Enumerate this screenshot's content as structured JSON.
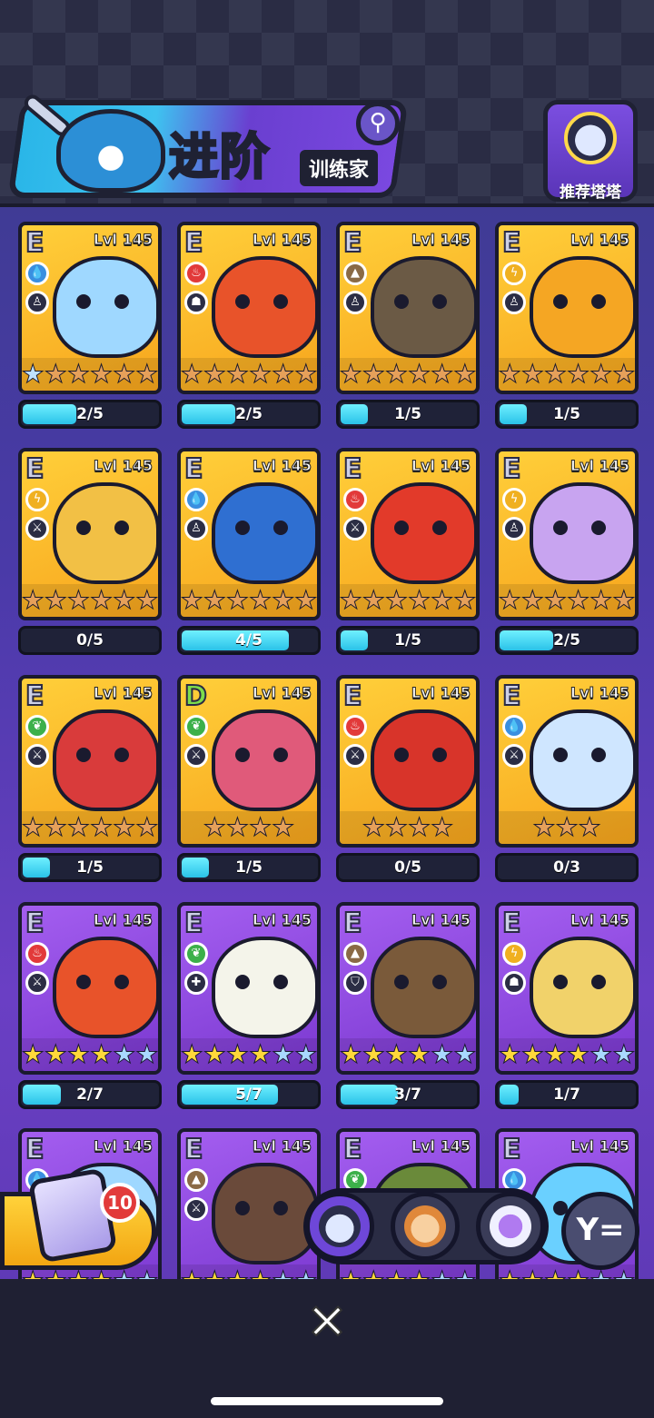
{
  "header": {
    "title": "进阶",
    "subtitle": "训练家",
    "recommend_label": "推荐塔塔",
    "icons": {
      "search": "search-icon",
      "recommend": "tata-robot-icon"
    }
  },
  "cards": [
    {
      "rank": "E",
      "level": "Lvl 145",
      "element": "water",
      "role": "bag",
      "stars": [
        "s",
        "b",
        "b",
        "b",
        "b",
        "b"
      ],
      "progress_text": "2/5",
      "progress": 0.4,
      "bg": "gold",
      "color": "#9fd8ff"
    },
    {
      "rank": "E",
      "level": "Lvl 145",
      "element": "fire",
      "role": "ghost",
      "stars": [
        "b",
        "b",
        "b",
        "b",
        "b",
        "b"
      ],
      "progress_text": "2/5",
      "progress": 0.4,
      "bg": "gold",
      "color": "#e8532a"
    },
    {
      "rank": "E",
      "level": "Lvl 145",
      "element": "earth",
      "role": "bag",
      "stars": [
        "b",
        "b",
        "b",
        "b",
        "b",
        "b"
      ],
      "progress_text": "1/5",
      "progress": 0.2,
      "bg": "gold",
      "color": "#6b5a45"
    },
    {
      "rank": "E",
      "level": "Lvl 145",
      "element": "electric",
      "role": "bag",
      "stars": [
        "b",
        "b",
        "b",
        "b",
        "b",
        "b"
      ],
      "progress_text": "1/5",
      "progress": 0.2,
      "bg": "gold",
      "color": "#f5a623"
    },
    {
      "rank": "E",
      "level": "Lvl 145",
      "element": "electric",
      "role": "sword",
      "stars": [
        "b",
        "b",
        "b",
        "b",
        "b",
        "b"
      ],
      "progress_text": "0/5",
      "progress": 0.0,
      "bg": "gold",
      "color": "#f2c045"
    },
    {
      "rank": "E",
      "level": "Lvl 145",
      "element": "water",
      "role": "bag",
      "stars": [
        "b",
        "b",
        "b",
        "b",
        "b",
        "b"
      ],
      "progress_text": "4/5",
      "progress": 0.8,
      "bg": "gold",
      "color": "#2f6fd1"
    },
    {
      "rank": "E",
      "level": "Lvl 145",
      "element": "fire",
      "role": "sword",
      "stars": [
        "b",
        "b",
        "b",
        "b",
        "b",
        "b"
      ],
      "progress_text": "1/5",
      "progress": 0.2,
      "bg": "gold",
      "color": "#e23a2a"
    },
    {
      "rank": "E",
      "level": "Lvl 145",
      "element": "electric",
      "role": "bag",
      "stars": [
        "b",
        "b",
        "b",
        "b",
        "b",
        "b"
      ],
      "progress_text": "2/5",
      "progress": 0.4,
      "bg": "gold",
      "color": "#c8a4f0"
    },
    {
      "rank": "E",
      "level": "Lvl 145",
      "element": "leaf",
      "role": "sword",
      "stars": [
        "b",
        "b",
        "b",
        "b",
        "b",
        "b"
      ],
      "progress_text": "1/5",
      "progress": 0.2,
      "bg": "gold",
      "color": "#d93b3b"
    },
    {
      "rank": "D",
      "level": "Lvl 145",
      "element": "leaf",
      "role": "sword",
      "stars": [
        "b",
        "b",
        "b",
        "b"
      ],
      "progress_text": "1/5",
      "progress": 0.2,
      "bg": "gold",
      "color": "#e05a7a"
    },
    {
      "rank": "E",
      "level": "Lvl 145",
      "element": "fire",
      "role": "sword",
      "stars": [
        "b",
        "b",
        "b",
        "b"
      ],
      "progress_text": "0/5",
      "progress": 0.0,
      "bg": "gold",
      "color": "#d8342a"
    },
    {
      "rank": "E",
      "level": "Lvl 145",
      "element": "water",
      "role": "sword",
      "stars": [
        "b",
        "b",
        "b"
      ],
      "progress_text": "0/3",
      "progress": 0.0,
      "bg": "gold",
      "color": "#cfe6ff"
    },
    {
      "rank": "E",
      "level": "Lvl 145",
      "element": "fire",
      "role": "sword",
      "stars": [
        "g",
        "g",
        "g",
        "g",
        "e",
        "e"
      ],
      "progress_text": "2/7",
      "progress": 0.2857,
      "bg": "purple",
      "color": "#e8532a"
    },
    {
      "rank": "E",
      "level": "Lvl 145",
      "element": "leaf",
      "role": "heal",
      "stars": [
        "g",
        "g",
        "g",
        "g",
        "e",
        "e"
      ],
      "progress_text": "5/7",
      "progress": 0.714,
      "bg": "purple",
      "color": "#f4f4ea"
    },
    {
      "rank": "E",
      "level": "Lvl 145",
      "element": "earth",
      "role": "shield",
      "stars": [
        "g",
        "g",
        "g",
        "g",
        "e",
        "e"
      ],
      "progress_text": "3/7",
      "progress": 0.4286,
      "bg": "purple",
      "color": "#7a5a3a"
    },
    {
      "rank": "E",
      "level": "Lvl 145",
      "element": "electric",
      "role": "ghost",
      "stars": [
        "g",
        "g",
        "g",
        "g",
        "e",
        "e"
      ],
      "progress_text": "1/7",
      "progress": 0.1429,
      "bg": "purple",
      "color": "#f1d26a"
    },
    {
      "rank": "E",
      "level": "Lvl 145",
      "element": "water",
      "role": "sword",
      "stars": [
        "g",
        "g",
        "g",
        "g",
        "e",
        "e"
      ],
      "progress_text": "",
      "progress": 0.0,
      "bg": "purple",
      "color": "#9fd8ff"
    },
    {
      "rank": "E",
      "level": "Lvl 145",
      "element": "earth",
      "role": "sword",
      "stars": [
        "g",
        "g",
        "g",
        "g",
        "e",
        "e"
      ],
      "progress_text": "",
      "progress": 0.0,
      "bg": "purple",
      "color": "#6a4a3a"
    },
    {
      "rank": "E",
      "level": "Lvl 145",
      "element": "leaf",
      "role": "sword",
      "stars": [
        "g",
        "g",
        "g",
        "g",
        "e",
        "e"
      ],
      "progress_text": "",
      "progress": 0.0,
      "bg": "purple",
      "color": "#6a8a3a"
    },
    {
      "rank": "E",
      "level": "Lvl 145",
      "element": "water",
      "role": "sword",
      "stars": [
        "g",
        "g",
        "g",
        "g",
        "e",
        "e"
      ],
      "progress_text": "",
      "progress": 0.0,
      "bg": "purple",
      "color": "#6ad0ff"
    }
  ],
  "floating": {
    "chest_count": "10",
    "filter_icons": [
      "tata-robot-icon",
      "hamster-icon",
      "purple-star-icon"
    ],
    "sort_icon": "filter-sort-icon"
  },
  "bottom": {
    "close_icon": "close-icon"
  }
}
